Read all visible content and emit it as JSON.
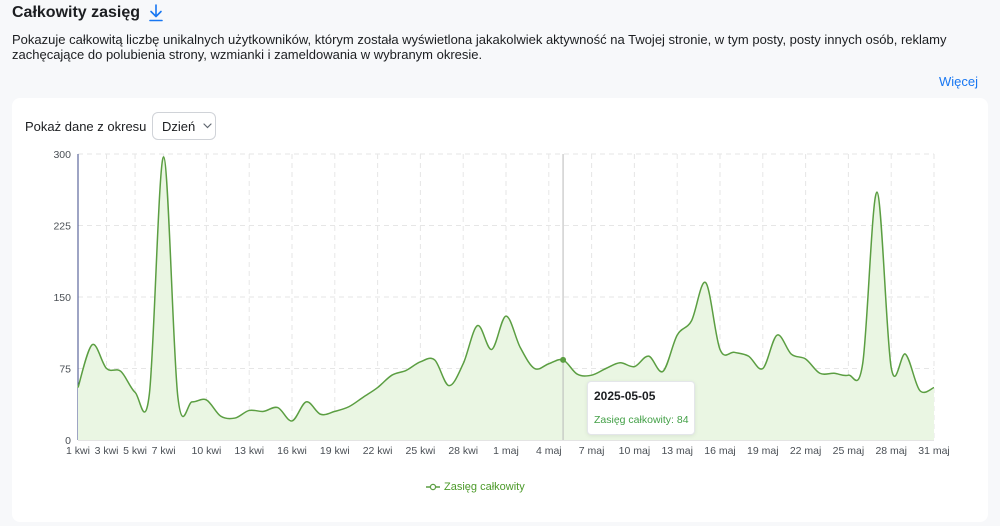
{
  "header": {
    "title": "Całkowity zasięg",
    "description": "Pokazuje całkowitą liczbę unikalnych użytkowników, którym została wyświetlona jakakolwiek aktywność na Twojej stronie, w tym posty, posty innych osób, reklamy zachęcające do polubienia strony, wzmianki i zameldowania w wybranym okresie.",
    "more_link": "Więcej"
  },
  "controls": {
    "range_label": "Pokaż dane z okresu",
    "period_value": "Dzień"
  },
  "tooltip": {
    "date": "2025-05-05",
    "label": "Zasięg całkowity: 84"
  },
  "colors": {
    "line": "#5b9e42",
    "fill": "#eaf6e3",
    "link": "#1877f2",
    "tooltip_value": "#43a047"
  },
  "icons": {
    "download": "download-icon",
    "chevron": "chevron-down-icon"
  },
  "chart_data": {
    "type": "area",
    "y_ticks": [
      0,
      75,
      150,
      225,
      300
    ],
    "ylim": [
      0,
      300
    ],
    "x_tick_labels": [
      "1 kwi",
      "3 kwi",
      "5 kwi",
      "7 kwi",
      "10 kwi",
      "13 kwi",
      "16 kwi",
      "19 kwi",
      "22 kwi",
      "25 kwi",
      "28 kwi",
      "1 maj",
      "4 maj",
      "7 maj",
      "10 maj",
      "13 maj",
      "16 maj",
      "19 maj",
      "22 maj",
      "25 maj",
      "28 maj",
      "31 maj"
    ],
    "x_tick_days": [
      0,
      2,
      4,
      6,
      9,
      12,
      15,
      18,
      21,
      24,
      27,
      30,
      33,
      36,
      39,
      42,
      45,
      48,
      51,
      54,
      57,
      60
    ],
    "series": [
      {
        "name": "Zasięg całkowity",
        "x": [
          "1 kwi",
          "2 kwi",
          "3 kwi",
          "4 kwi",
          "5 kwi",
          "6 kwi",
          "7 kwi",
          "8 kwi",
          "9 kwi",
          "10 kwi",
          "11 kwi",
          "12 kwi",
          "13 kwi",
          "14 kwi",
          "15 kwi",
          "16 kwi",
          "17 kwi",
          "18 kwi",
          "19 kwi",
          "20 kwi",
          "21 kwi",
          "22 kwi",
          "23 kwi",
          "24 kwi",
          "25 kwi",
          "26 kwi",
          "27 kwi",
          "28 kwi",
          "29 kwi",
          "30 kwi",
          "1 maj",
          "2 maj",
          "3 maj",
          "4 maj",
          "5 maj",
          "6 maj",
          "7 maj",
          "8 maj",
          "9 maj",
          "10 maj",
          "11 maj",
          "12 maj",
          "13 maj",
          "14 maj",
          "15 maj",
          "16 maj",
          "17 maj",
          "18 maj",
          "19 maj",
          "20 maj",
          "21 maj",
          "22 maj",
          "23 maj",
          "24 maj",
          "25 maj",
          "26 maj",
          "27 maj",
          "28 maj",
          "29 maj",
          "30 maj",
          "31 maj"
        ],
        "values": [
          55,
          100,
          75,
          72,
          50,
          48,
          297,
          45,
          40,
          42,
          25,
          23,
          31,
          30,
          34,
          20,
          40,
          27,
          30,
          35,
          45,
          55,
          68,
          73,
          82,
          84,
          57,
          80,
          120,
          95,
          130,
          97,
          75,
          80,
          84,
          69,
          68,
          75,
          81,
          77,
          88,
          72,
          110,
          125,
          165,
          95,
          92,
          88,
          75,
          110,
          90,
          85,
          70,
          70,
          68,
          80,
          260,
          76,
          90,
          52,
          55
        ]
      }
    ],
    "highlight": {
      "x": "5 maj",
      "value": 84
    },
    "grid": true,
    "legend_position": "bottom"
  }
}
